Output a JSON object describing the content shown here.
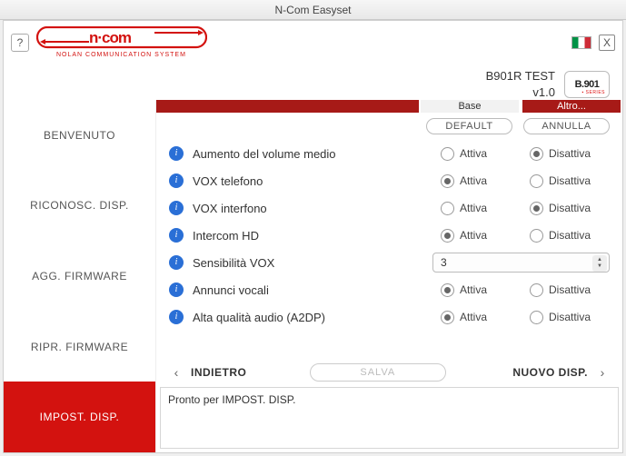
{
  "window": {
    "title": "N-Com Easyset",
    "close": "X",
    "help": "?"
  },
  "logo": {
    "brand_top": "n·com",
    "brand_sub": "NOLAN COMMUNICATION SYSTEM"
  },
  "device": {
    "name": "B901R TEST",
    "version": "v1.0",
    "badge": "B.901"
  },
  "sidebar": {
    "items": [
      {
        "label": "BENVENUTO"
      },
      {
        "label": "RICONOSC. DISP."
      },
      {
        "label": "AGG. FIRMWARE"
      },
      {
        "label": "RIPR. FIRMWARE"
      },
      {
        "label": "IMPOST. DISP."
      }
    ],
    "active_index": 4
  },
  "tabs": {
    "base": "Base",
    "altro": "Altro..."
  },
  "sub_buttons": {
    "default": "DEFAULT",
    "cancel": "ANNULLA"
  },
  "options": {
    "on": "Attiva",
    "off": "Disattiva"
  },
  "rows": [
    {
      "label": "Aumento del volume medio",
      "value": "off"
    },
    {
      "label": "VOX telefono",
      "value": "on"
    },
    {
      "label": "VOX interfono",
      "value": "off"
    },
    {
      "label": "Intercom HD",
      "value": "on"
    },
    {
      "label": "Sensibilità VOX",
      "select": "3"
    },
    {
      "label": "Annunci vocali",
      "value": "on"
    },
    {
      "label": "Alta qualità audio (A2DP)",
      "value": "on"
    }
  ],
  "nav": {
    "back": "INDIETRO",
    "save": "SALVA",
    "next": "NUOVO DISP."
  },
  "status": "Pronto per IMPOST. DISP."
}
